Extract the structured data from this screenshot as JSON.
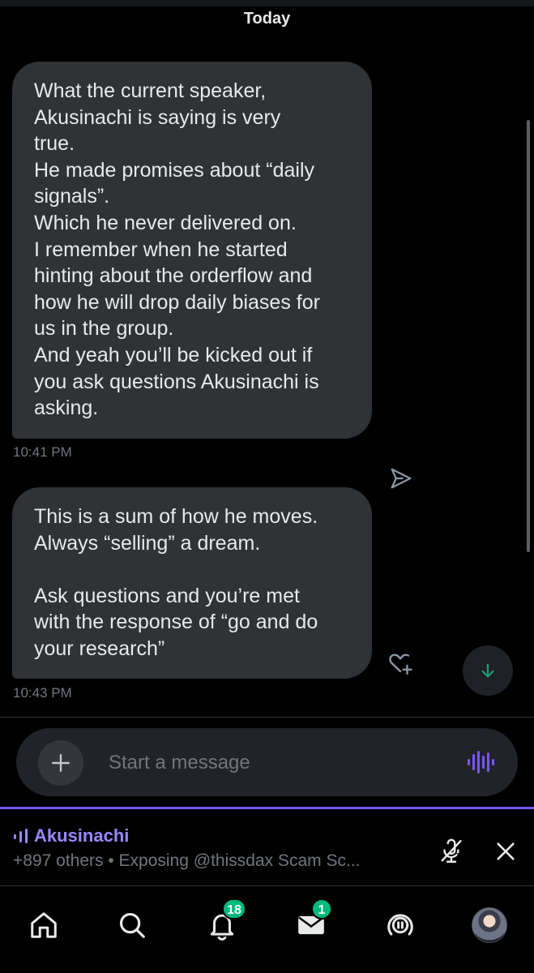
{
  "chat": {
    "date_label": "Today",
    "messages": [
      {
        "text": "What the current speaker,\nAkusinachi is saying is very\ntrue.\nHe made promises about “daily\nsignals”.\nWhich he never delivered on.\nI remember when he started\nhinting about the orderflow and\nhow he will drop daily biases for\nus in the group.\nAnd yeah you’ll be kicked out if\nyou ask questions Akusinachi is\nasking.",
        "time": "10:41 PM"
      },
      {
        "text": "This is a sum of how he moves.\nAlways “selling” a dream.\n\nAsk questions and you’re met\nwith the response of “go and do\nyour research”",
        "time": "10:43 PM"
      }
    ]
  },
  "composer": {
    "placeholder": "Start a message"
  },
  "space": {
    "host": "Akusinachi",
    "subtitle": "+897 others • Exposing @thissdax Scam Sc..."
  },
  "nav": {
    "notifications_badge": "18",
    "messages_badge": "1"
  },
  "colors": {
    "accent": "#7856ff",
    "badge": "#00ba7c",
    "bubble": "#2f3336"
  }
}
